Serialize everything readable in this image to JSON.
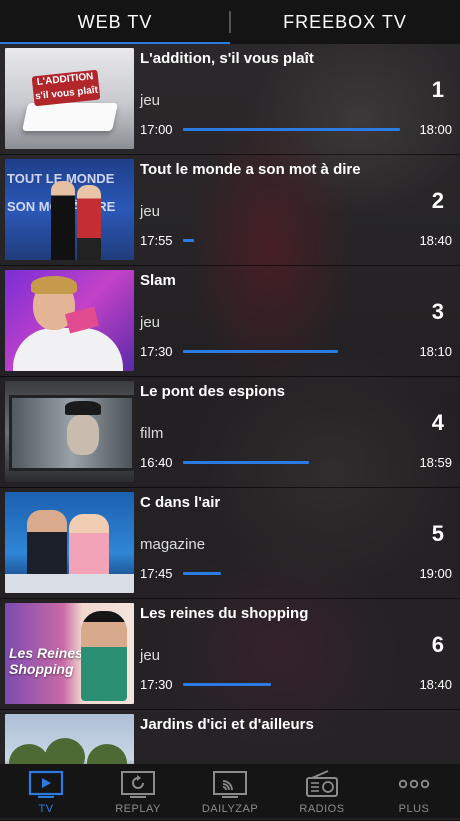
{
  "top_tabs": [
    {
      "label": "WEB TV",
      "active": true
    },
    {
      "label": "FREEBOX TV",
      "active": false
    }
  ],
  "accent_color": "#2a7be3",
  "programs": [
    {
      "title": "L'addition, s'il vous plaît",
      "genre": "jeu",
      "channel": "1",
      "start": "17:00",
      "end": "18:00",
      "progress": 0.98,
      "thumb": "show-thumbnail",
      "thumb_text": "L'ADDITION s'il vous plaît"
    },
    {
      "title": "Tout le monde a son mot à dire",
      "genre": "jeu",
      "channel": "2",
      "start": "17:55",
      "end": "18:40",
      "progress": 0.05,
      "thumb": "show-thumbnail",
      "thumb_text": "TOUT LE MONDE SON MOT À DIRE"
    },
    {
      "title": "Slam",
      "genre": "jeu",
      "channel": "3",
      "start": "17:30",
      "end": "18:10",
      "progress": 0.7,
      "thumb": "show-thumbnail"
    },
    {
      "title": "Le pont des espions",
      "genre": "film",
      "channel": "4",
      "start": "16:40",
      "end": "18:59",
      "progress": 0.57,
      "thumb": "movie-thumbnail"
    },
    {
      "title": "C dans l'air",
      "genre": "magazine",
      "channel": "5",
      "start": "17:45",
      "end": "19:00",
      "progress": 0.17,
      "thumb": "show-thumbnail"
    },
    {
      "title": "Les reines du shopping",
      "genre": "jeu",
      "channel": "6",
      "start": "17:30",
      "end": "18:40",
      "progress": 0.4,
      "thumb": "show-thumbnail",
      "thumb_text": "Les Reines du Shopping"
    },
    {
      "title": "Jardins d'ici et d'ailleurs",
      "genre": "",
      "channel": "",
      "start": "",
      "end": "",
      "progress": 0,
      "thumb": "show-thumbnail"
    }
  ],
  "bottom_tabs": [
    {
      "label": "TV",
      "icon": "tv-play-icon",
      "active": true
    },
    {
      "label": "REPLAY",
      "icon": "replay-icon",
      "active": false
    },
    {
      "label": "DAILYZAP",
      "icon": "cast-icon",
      "active": false
    },
    {
      "label": "RADIOS",
      "icon": "radio-icon",
      "active": false
    },
    {
      "label": "PLUS",
      "icon": "more-icon",
      "active": false
    }
  ]
}
